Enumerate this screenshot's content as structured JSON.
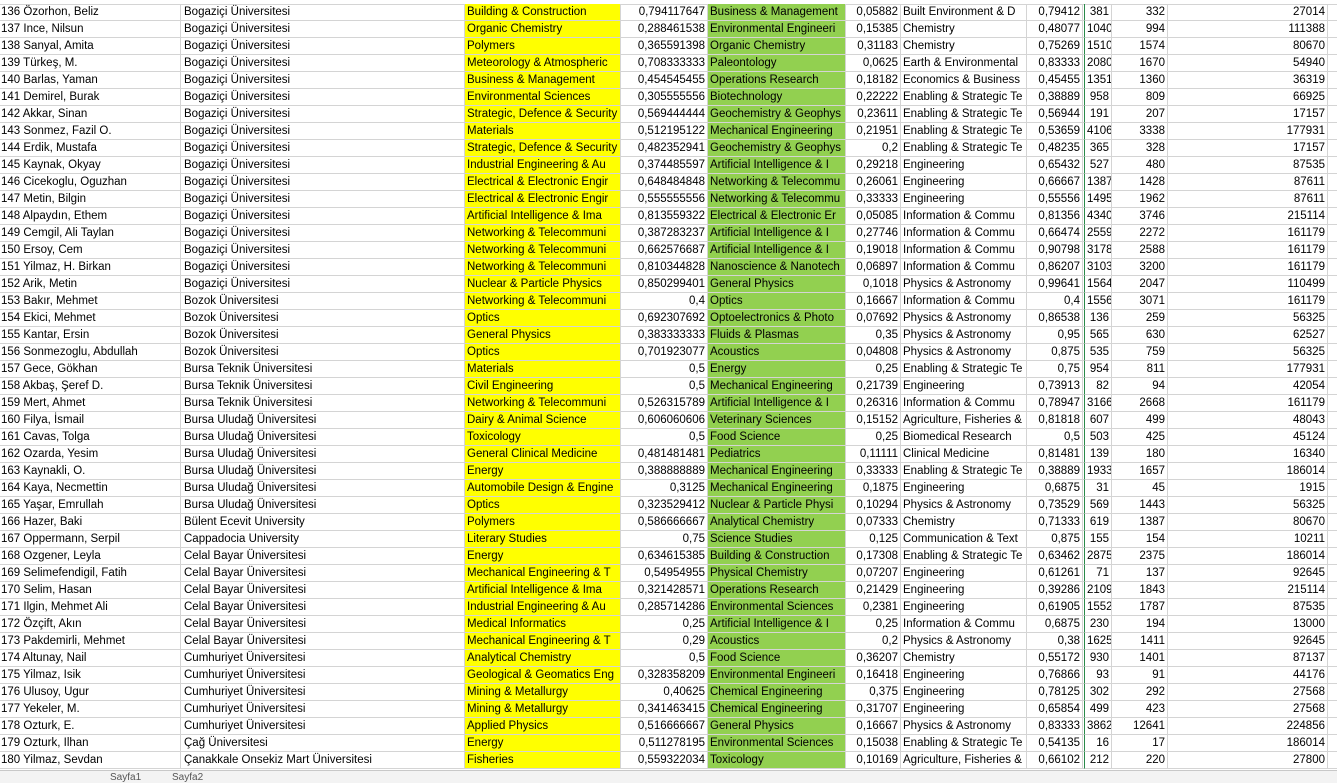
{
  "colors": {
    "yellow": "#ffff00",
    "green": "#92d050",
    "grid_line": "#d4d4d4",
    "active_tab": "#217346"
  },
  "rows": [
    [
      "136 Özorhon, Beliz",
      "Bogaziçi Üniversitesi",
      "Building & Construction",
      "0,794117647",
      "Business & Management",
      "0,05882",
      "Built Environment & D",
      "0,79412",
      "",
      "381",
      "332",
      "27014"
    ],
    [
      "137 Ince, Nilsun",
      "Bogaziçi Üniversitesi",
      "Organic Chemistry",
      "0,288461538",
      "Environmental Engineeri",
      "0,15385",
      "Chemistry",
      "0,48077",
      "",
      "1040",
      "994",
      "111388"
    ],
    [
      "138 Sanyal, Amita",
      "Bogaziçi Üniversitesi",
      "Polymers",
      "0,365591398",
      "Organic Chemistry",
      "0,31183",
      "Chemistry",
      "0,75269",
      "",
      "1510",
      "1574",
      "80670"
    ],
    [
      "139 Türkeş, M.",
      "Bogaziçi Üniversitesi",
      "Meteorology & Atmospheric",
      "0,708333333",
      "Paleontology",
      "0,0625",
      "Earth & Environmental",
      "0,83333",
      "",
      "2080",
      "1670",
      "54940"
    ],
    [
      "140 Barlas, Yaman",
      "Bogaziçi Üniversitesi",
      "Business & Management",
      "0,454545455",
      "Operations Research",
      "0,18182",
      "Economics & Business",
      "0,45455",
      "",
      "1351",
      "1360",
      "36319"
    ],
    [
      "141 Demirel, Burak",
      "Bogaziçi Üniversitesi",
      "Environmental Sciences",
      "0,305555556",
      "Biotechnology",
      "0,22222",
      "Enabling & Strategic Te",
      "0,38889",
      "",
      "958",
      "809",
      "66925"
    ],
    [
      "142 Akkar, Sinan",
      "Bogaziçi Üniversitesi",
      "Strategic, Defence & Security",
      "0,569444444",
      "Geochemistry & Geophys",
      "0,23611",
      "Enabling & Strategic Te",
      "0,56944",
      "",
      "191",
      "207",
      "17157"
    ],
    [
      "143 Sonmez, Fazil O.",
      "Bogaziçi Üniversitesi",
      "Materials",
      "0,512195122",
      "Mechanical Engineering",
      "0,21951",
      "Enabling & Strategic Te",
      "0,53659",
      "",
      "4106",
      "3338",
      "177931"
    ],
    [
      "144 Erdik, Mustafa",
      "Bogaziçi Üniversitesi",
      "Strategic, Defence & Security",
      "0,482352941",
      "Geochemistry & Geophys",
      "0,2",
      "Enabling & Strategic Te",
      "0,48235",
      "",
      "365",
      "328",
      "17157"
    ],
    [
      "145 Kaynak, Okyay",
      "Bogaziçi Üniversitesi",
      "Industrial Engineering & Au",
      "0,374485597",
      "Artificial Intelligence & I",
      "0,29218",
      "Engineering",
      "0,65432",
      "",
      "527",
      "480",
      "87535"
    ],
    [
      "146 Cicekoglu, Oguzhan",
      "Bogaziçi Üniversitesi",
      "Electrical & Electronic Engir",
      "0,648484848",
      "Networking & Telecommu",
      "0,26061",
      "Engineering",
      "0,66667",
      "",
      "1387",
      "1428",
      "87611"
    ],
    [
      "147 Metin, Bilgin",
      "Bogaziçi Üniversitesi",
      "Electrical & Electronic Engir",
      "0,555555556",
      "Networking & Telecommu",
      "0,33333",
      "Engineering",
      "0,55556",
      "",
      "1495",
      "1962",
      "87611"
    ],
    [
      "148 Alpaydın, Ethem",
      "Bogaziçi Üniversitesi",
      "Artificial Intelligence & Ima",
      "0,813559322",
      "Electrical & Electronic Er",
      "0,05085",
      "Information & Commu",
      "0,81356",
      "",
      "4340",
      "3746",
      "215114"
    ],
    [
      "149 Cemgil, Ali Taylan",
      "Bogaziçi Üniversitesi",
      "Networking & Telecommuni",
      "0,387283237",
      "Artificial Intelligence & I",
      "0,27746",
      "Information & Commu",
      "0,66474",
      "",
      "2559",
      "2272",
      "161179"
    ],
    [
      "150 Ersoy, Cem",
      "Bogaziçi Üniversitesi",
      "Networking & Telecommuni",
      "0,662576687",
      "Artificial Intelligence & I",
      "0,19018",
      "Information & Commu",
      "0,90798",
      "",
      "3178",
      "2588",
      "161179"
    ],
    [
      "151 Yilmaz, H. Birkan",
      "Bogaziçi Üniversitesi",
      "Networking & Telecommuni",
      "0,810344828",
      "Nanoscience & Nanotech",
      "0,06897",
      "Information & Commu",
      "0,86207",
      "",
      "3103",
      "3200",
      "161179"
    ],
    [
      "152 Arik, Metin",
      "Bogaziçi Üniversitesi",
      "Nuclear & Particle Physics",
      "0,850299401",
      "General Physics",
      "0,1018",
      "Physics & Astronomy",
      "0,99641",
      "",
      "1564",
      "2047",
      "110499"
    ],
    [
      "153 Bakır, Mehmet",
      "Bozok Üniversitesi",
      "Networking & Telecommuni",
      "0,4",
      "Optics",
      "0,16667",
      "Information & Commu",
      "0,4",
      "",
      "1556",
      "3071",
      "161179"
    ],
    [
      "154 Ekici, Mehmet",
      "Bozok Üniversitesi",
      "Optics",
      "0,692307692",
      "Optoelectronics & Photo",
      "0,07692",
      "Physics & Astronomy",
      "0,86538",
      "",
      "136",
      "259",
      "56325"
    ],
    [
      "155 Kantar, Ersin",
      "Bozok Üniversitesi",
      "General Physics",
      "0,383333333",
      "Fluids & Plasmas",
      "0,35",
      "Physics & Astronomy",
      "0,95",
      "",
      "565",
      "630",
      "62527"
    ],
    [
      "156 Sonmezoglu, Abdullah",
      "Bozok Üniversitesi",
      "Optics",
      "0,701923077",
      "Acoustics",
      "0,04808",
      "Physics & Astronomy",
      "0,875",
      "",
      "535",
      "759",
      "56325"
    ],
    [
      "157 Gece, Gökhan",
      "Bursa Teknik Üniversitesi",
      "Materials",
      "0,5",
      "Energy",
      "0,25",
      "Enabling & Strategic Te",
      "0,75",
      "",
      "954",
      "811",
      "177931"
    ],
    [
      "158 Akbaş, Şeref D.",
      "Bursa Teknik Üniversitesi",
      "Civil Engineering",
      "0,5",
      "Mechanical Engineering",
      "0,21739",
      "Engineering",
      "0,73913",
      "",
      "82",
      "94",
      "42054"
    ],
    [
      "159 Mert, Ahmet",
      "Bursa Teknik Üniversitesi",
      "Networking & Telecommuni",
      "0,526315789",
      "Artificial Intelligence & I",
      "0,26316",
      "Information & Commu",
      "0,78947",
      "",
      "3166",
      "2668",
      "161179"
    ],
    [
      "160 Filya, İsmail",
      "Bursa Uludağ Üniversitesi",
      "Dairy & Animal Science",
      "0,606060606",
      "Veterinary Sciences",
      "0,15152",
      "Agriculture, Fisheries &",
      "0,81818",
      "",
      "607",
      "499",
      "48043"
    ],
    [
      "161 Cavas, Tolga",
      "Bursa Uludağ Üniversitesi",
      "Toxicology",
      "0,5",
      "Food Science",
      "0,25",
      "Biomedical Research",
      "0,5",
      "",
      "503",
      "425",
      "45124"
    ],
    [
      "162 Ozarda, Yesim",
      "Bursa Uludağ Üniversitesi",
      "General Clinical Medicine",
      "0,481481481",
      "Pediatrics",
      "0,11111",
      "Clinical Medicine",
      "0,81481",
      "",
      "139",
      "180",
      "16340"
    ],
    [
      "163 Kaynakli, O.",
      "Bursa Uludağ Üniversitesi",
      "Energy",
      "0,388888889",
      "Mechanical Engineering",
      "0,33333",
      "Enabling & Strategic Te",
      "0,38889",
      "",
      "1933",
      "1657",
      "186014"
    ],
    [
      "164 Kaya, Necmettin",
      "Bursa Uludağ Üniversitesi",
      "Automobile Design & Engine",
      "0,3125",
      "Mechanical Engineering",
      "0,1875",
      "Engineering",
      "0,6875",
      "",
      "31",
      "45",
      "1915"
    ],
    [
      "165 Yaşar, Emrullah",
      "Bursa Uludağ Üniversitesi",
      "Optics",
      "0,323529412",
      "Nuclear & Particle Physi",
      "0,10294",
      "Physics & Astronomy",
      "0,73529",
      "",
      "569",
      "1443",
      "56325"
    ],
    [
      "166 Hazer, Baki",
      "Bülent Ecevit University",
      "Polymers",
      "0,586666667",
      "Analytical Chemistry",
      "0,07333",
      "Chemistry",
      "0,71333",
      "",
      "619",
      "1387",
      "80670"
    ],
    [
      "167 Oppermann, Serpil",
      "Cappadocia University",
      "Literary Studies",
      "0,75",
      "Science Studies",
      "0,125",
      "Communication & Text",
      "0,875",
      "",
      "155",
      "154",
      "10211"
    ],
    [
      "168 Ozgener, Leyla",
      "Celal Bayar Üniversitesi",
      "Energy",
      "0,634615385",
      "Building & Construction",
      "0,17308",
      "Enabling & Strategic Te",
      "0,63462",
      "",
      "2875",
      "2375",
      "186014"
    ],
    [
      "169 Selimefendigil, Fatih",
      "Celal Bayar Üniversitesi",
      "Mechanical Engineering & T",
      "0,54954955",
      "Physical Chemistry",
      "0,07207",
      "Engineering",
      "0,61261",
      "",
      "71",
      "137",
      "92645"
    ],
    [
      "170 Selim, Hasan",
      "Celal Bayar Üniversitesi",
      "Artificial Intelligence & Ima",
      "0,321428571",
      "Operations Research",
      "0,21429",
      "Engineering",
      "0,39286",
      "",
      "2109",
      "1843",
      "215114"
    ],
    [
      "171 Ilgin, Mehmet Ali",
      "Celal Bayar Üniversitesi",
      "Industrial Engineering & Au",
      "0,285714286",
      "Environmental Sciences",
      "0,2381",
      "Engineering",
      "0,61905",
      "",
      "1552",
      "1787",
      "87535"
    ],
    [
      "172 Özçift, Akın",
      "Celal Bayar Üniversitesi",
      "Medical Informatics",
      "0,25",
      "Artificial Intelligence & I",
      "0,25",
      "Information & Commu",
      "0,6875",
      "",
      "230",
      "194",
      "13000"
    ],
    [
      "173 Pakdemirli, Mehmet",
      "Celal Bayar Üniversitesi",
      "Mechanical Engineering & T",
      "0,29",
      "Acoustics",
      "0,2",
      "Physics & Astronomy",
      "0,38",
      "",
      "1625",
      "1411",
      "92645"
    ],
    [
      "174 Altunay, Nail",
      "Cumhuriyet Üniversitesi",
      "Analytical Chemistry",
      "0,5",
      "Food Science",
      "0,36207",
      "Chemistry",
      "0,55172",
      "",
      "930",
      "1401",
      "87137"
    ],
    [
      "175 Yilmaz, Isik",
      "Cumhuriyet Üniversitesi",
      "Geological & Geomatics Eng",
      "0,328358209",
      "Environmental Engineeri",
      "0,16418",
      "Engineering",
      "0,76866",
      "",
      "93",
      "91",
      "44176"
    ],
    [
      "176 Ulusoy, Ugur",
      "Cumhuriyet Üniversitesi",
      "Mining & Metallurgy",
      "0,40625",
      "Chemical Engineering",
      "0,375",
      "Engineering",
      "0,78125",
      "",
      "302",
      "292",
      "27568"
    ],
    [
      "177 Yekeler, M.",
      "Cumhuriyet Üniversitesi",
      "Mining & Metallurgy",
      "0,341463415",
      "Chemical Engineering",
      "0,31707",
      "Engineering",
      "0,65854",
      "",
      "499",
      "423",
      "27568"
    ],
    [
      "178 Ozturk, E.",
      "Cumhuriyet Üniversitesi",
      "Applied Physics",
      "0,516666667",
      "General Physics",
      "0,16667",
      "Physics & Astronomy",
      "0,83333",
      "",
      "3862",
      "12641",
      "224856"
    ],
    [
      "179 Ozturk, Ilhan",
      "Çağ Üniversitesi",
      "Energy",
      "0,511278195",
      "Environmental Sciences",
      "0,15038",
      "Enabling & Strategic Te",
      "0,54135",
      "",
      "16",
      "17",
      "186014"
    ],
    [
      "180 Yilmaz, Sevdan",
      "Çanakkale Onsekiz Mart Üniversitesi",
      "Fisheries",
      "0,559322034",
      "Toxicology",
      "0,10169",
      "Agriculture, Fisheries &",
      "0,66102",
      "",
      "212",
      "220",
      "27800"
    ]
  ],
  "sheet_tabs": [
    "Sayfa1",
    "Sayfa2"
  ]
}
